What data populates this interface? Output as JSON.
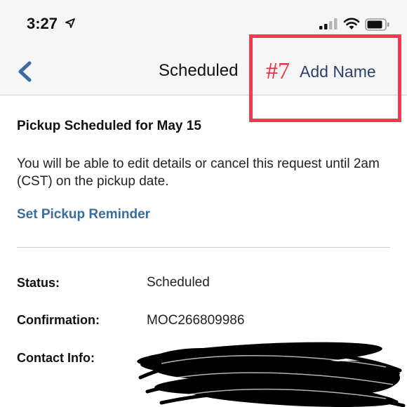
{
  "status_bar": {
    "time": "3:27",
    "icons": [
      "location-arrow-icon",
      "cellular-signal-icon",
      "wifi-icon",
      "battery-icon"
    ]
  },
  "nav": {
    "back_icon": "chevron-left-icon",
    "title": "Scheduled",
    "annotation": "#7",
    "action_label": "Add Name",
    "annotation_color": "#f23a4f"
  },
  "content": {
    "heading": "Pickup Scheduled for May 15",
    "info": "You will be able to edit details or cancel this request until 2am (CST) on the pickup date.",
    "reminder_link": "Set Pickup Reminder",
    "link_color": "#3a6c9c",
    "details": [
      {
        "label": "Status:",
        "value": "Scheduled"
      },
      {
        "label": "Confirmation:",
        "value": "MOC266809986"
      },
      {
        "label": "Contact Info:",
        "value": ""
      }
    ]
  }
}
